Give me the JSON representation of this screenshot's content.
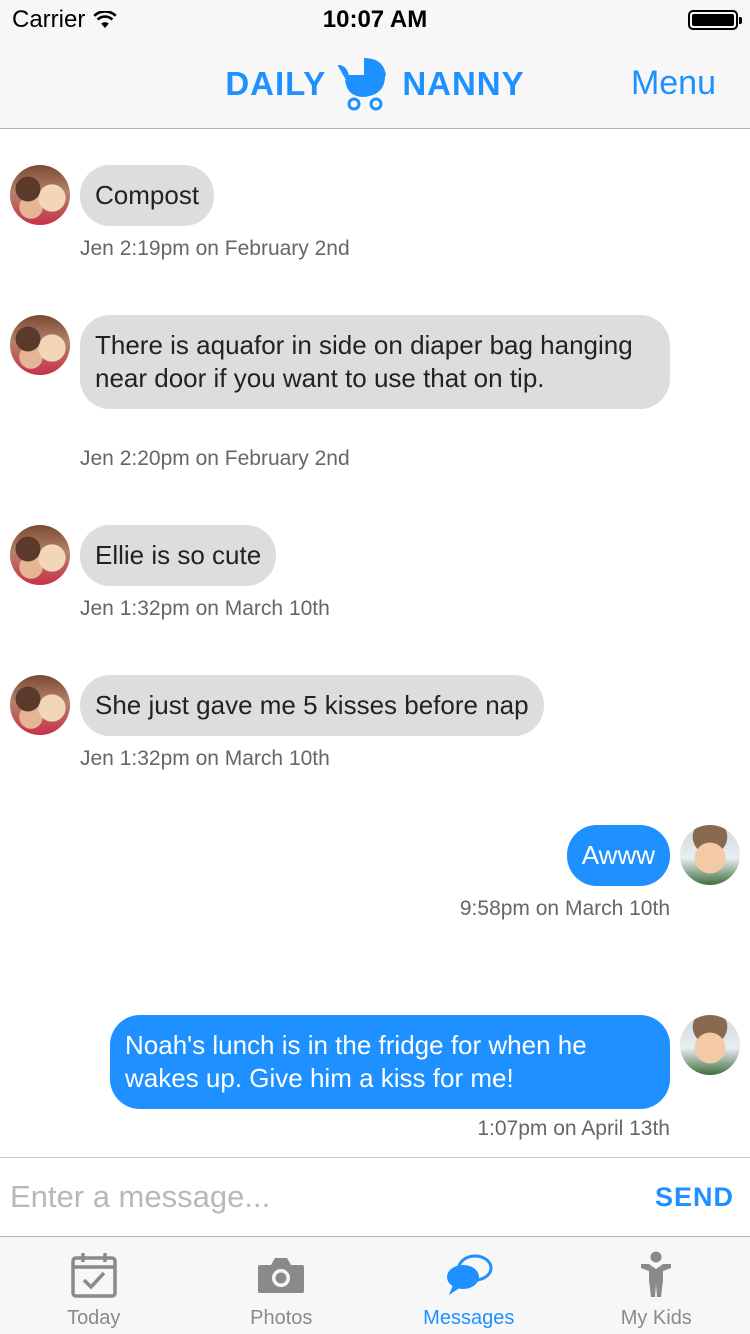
{
  "status_bar": {
    "carrier": "Carrier",
    "time": "10:07 AM"
  },
  "header": {
    "logo_left": "DAILY",
    "logo_right": "NANNY",
    "menu_label": "Menu"
  },
  "messages": [
    {
      "direction": "in",
      "sender": "Jen",
      "text": "Compost",
      "timestamp": "Jen 2:19pm on February 2nd"
    },
    {
      "direction": "in",
      "sender": "Jen",
      "text": "There is aquafor in side on diaper bag hanging near door if you want to use that on tip.",
      "timestamp": "Jen 2:20pm on February 2nd"
    },
    {
      "direction": "in",
      "sender": "Jen",
      "text": "Ellie is so cute",
      "timestamp": "Jen 1:32pm on March 10th"
    },
    {
      "direction": "in",
      "sender": "Jen",
      "text": "She just gave me 5 kisses before nap",
      "timestamp": "Jen 1:32pm on March 10th"
    },
    {
      "direction": "out",
      "text": "Awww",
      "timestamp": "9:58pm on March 10th"
    },
    {
      "direction": "out",
      "text": "Noah's lunch is in the fridge for when he wakes up. Give him a kiss for me!",
      "timestamp": "1:07pm on April 13th"
    }
  ],
  "composer": {
    "placeholder": "Enter a message...",
    "value": "",
    "send_label": "SEND"
  },
  "tabs": [
    {
      "label": "Today",
      "icon": "calendar-check-icon",
      "active": false
    },
    {
      "label": "Photos",
      "icon": "camera-icon",
      "active": false
    },
    {
      "label": "Messages",
      "icon": "chat-bubbles-icon",
      "active": true
    },
    {
      "label": "My Kids",
      "icon": "child-icon",
      "active": false
    }
  ],
  "colors": {
    "accent": "#1e90ff",
    "incoming_bubble": "#dddddd",
    "outgoing_bubble": "#1e90ff",
    "inactive_tab": "#8a8a8a"
  }
}
